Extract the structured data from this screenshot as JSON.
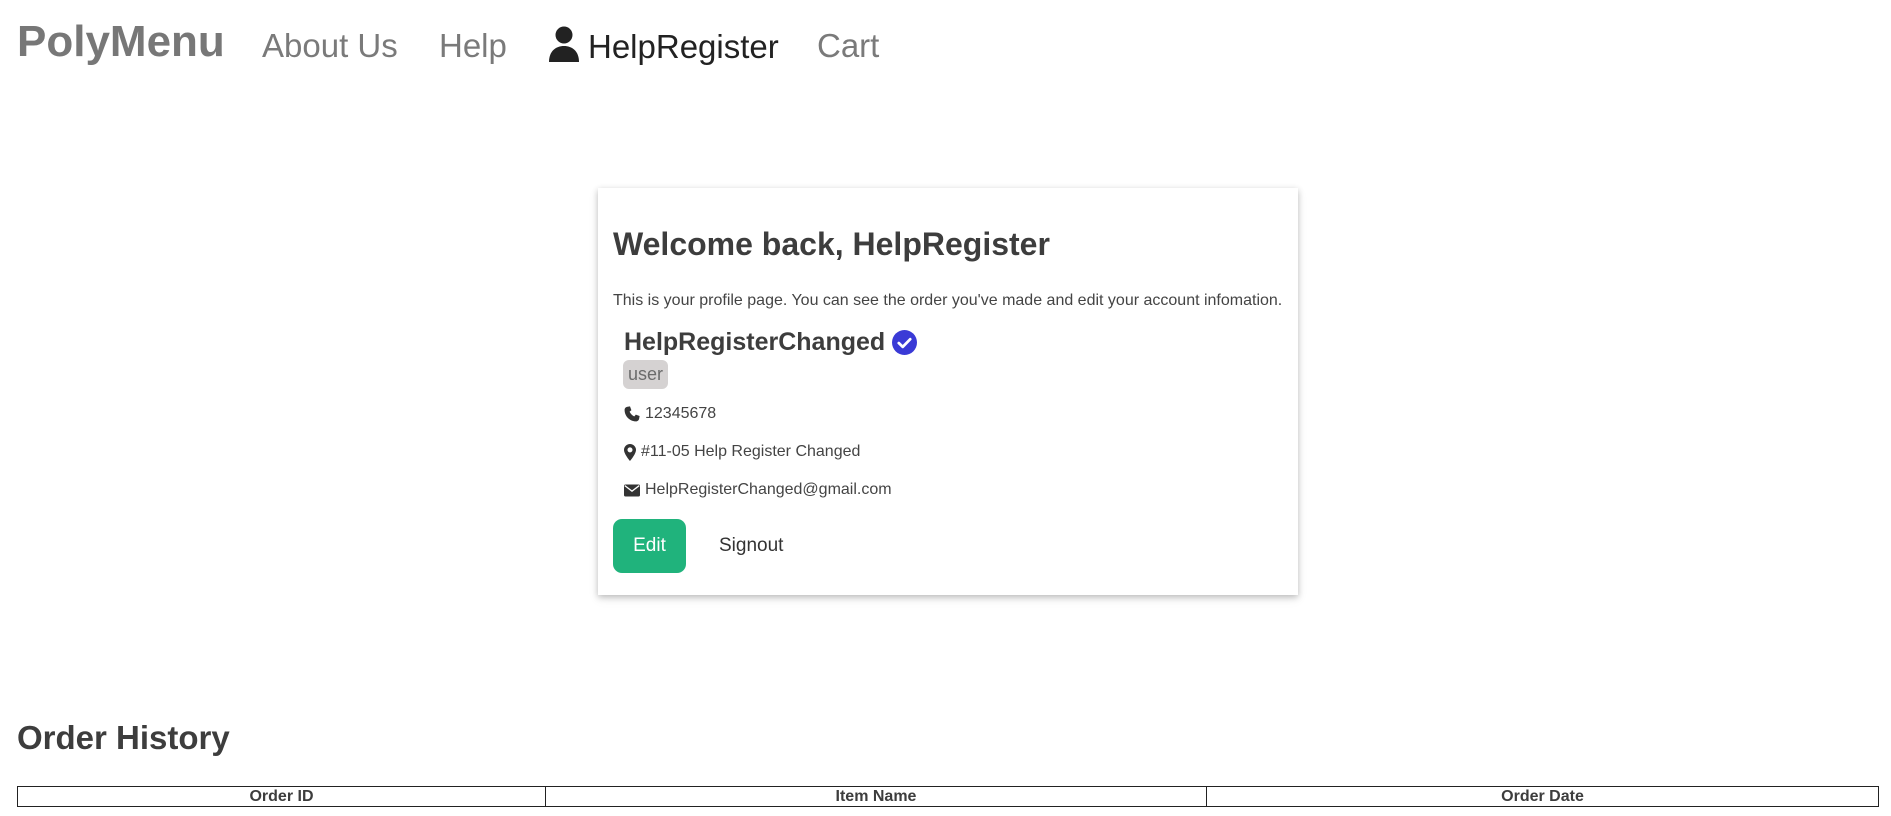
{
  "nav": {
    "brand": "PolyMenu",
    "items": [
      {
        "label": "About Us"
      },
      {
        "label": "Help"
      },
      {
        "label": "HelpRegister",
        "icon": "user-icon"
      },
      {
        "label": "Cart"
      }
    ]
  },
  "profile": {
    "welcome": "Welcome back, HelpRegister",
    "description": "This is your profile page. You can see the order you've made and edit your account infomation.",
    "username": "HelpRegisterChanged",
    "verified_icon": "check-circle-icon",
    "role": "user",
    "phone": "12345678",
    "address": "#11-05 Help Register Changed",
    "email": "HelpRegisterChanged@gmail.com",
    "edit_label": "Edit",
    "signout_label": "Signout"
  },
  "orders": {
    "title": "Order History",
    "columns": [
      "Order ID",
      "Item Name",
      "Order Date"
    ],
    "rows": []
  },
  "colors": {
    "accent_green": "#20b37c",
    "verified_blue": "#3a3ad6",
    "badge_gray": "#d5d2d2"
  }
}
